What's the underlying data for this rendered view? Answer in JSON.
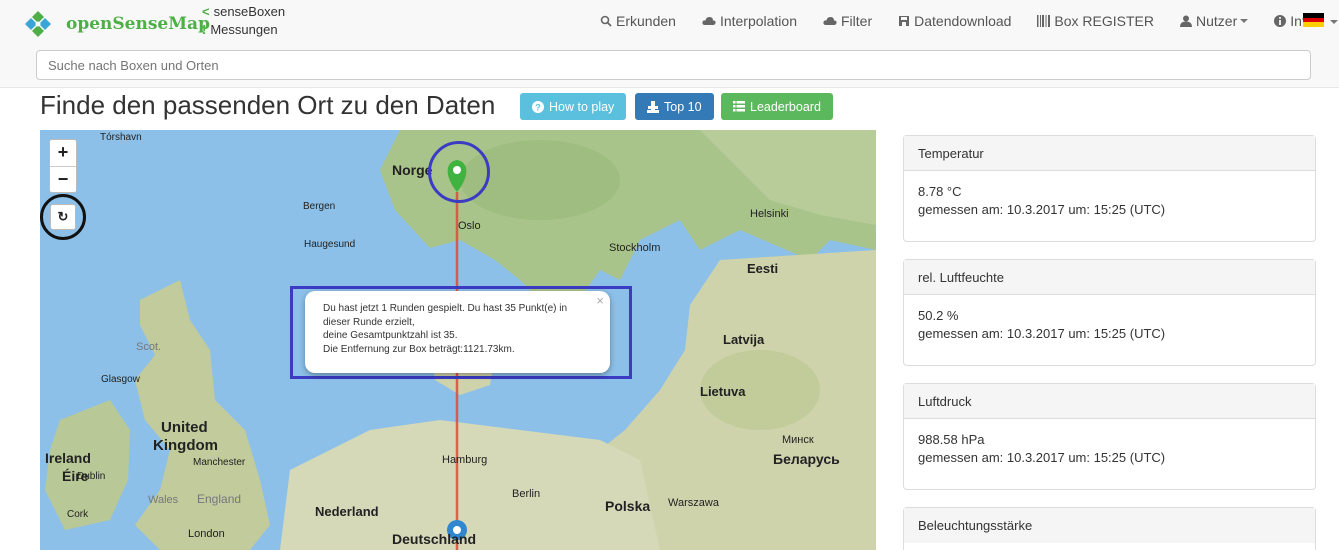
{
  "brand": {
    "name": "openSenseMap"
  },
  "sublinks": [
    {
      "mark": "<",
      "label": "senseBoxen"
    },
    {
      "mark": "!",
      "label": "Messungen"
    }
  ],
  "nav": {
    "explore": "Erkunden",
    "interpolation": "Interpolation",
    "filter": "Filter",
    "download": "Datendownload",
    "register": "Box REGISTER",
    "user": "Nutzer",
    "info": "Info"
  },
  "search": {
    "placeholder": "Suche nach Boxen und Orten"
  },
  "page": {
    "title": "Finde den passenden Ort zu den Daten"
  },
  "buttons": {
    "how": "How to play",
    "top": "Top 10",
    "leaderboard": "Leaderboard"
  },
  "map": {
    "labels": {
      "torshavn": "Tórshavn",
      "norge": "Norge",
      "bergen": "Bergen",
      "oslo": "Oslo",
      "haugesund": "Haugesund",
      "stockholm": "Stockholm",
      "helsinki": "Helsinki",
      "eesti": "Eesti",
      "latvija": "Latvija",
      "lietuva": "Lietuva",
      "scot": "Scot.",
      "glasgow": "Glasgow",
      "united": "United",
      "kingdom": "Kingdom",
      "ireland": "Ireland",
      "eire": "Éire",
      "manchester": "Manchester",
      "dublin": "Dublin",
      "wales": "Wales",
      "england": "England",
      "cork": "Cork",
      "london": "London",
      "hamburg": "Hamburg",
      "berlin": "Berlin",
      "nederland": "Nederland",
      "polska": "Polska",
      "warszawa": "Warszawa",
      "minsk": "Минск",
      "belarus": "Беларусь",
      "deutschland": "Deutschland"
    },
    "colors": {
      "water": "#8cc0e8",
      "land": "#d8dcc0",
      "forest": "#a9c48a",
      "line": "#e04a3a",
      "guess_pin": "#3fb23f",
      "box_pin": "#3087d0",
      "highlight_blue": "#3b3bc4",
      "highlight_black": "#111111"
    }
  },
  "zoom": {
    "in": "+",
    "out": "−",
    "reset": "↻"
  },
  "popup": {
    "close": "×",
    "line1": "Du hast jetzt 1 Runden gespielt. Du hast 35 Punkt(e) in",
    "line2": "dieser Runde erzielt,",
    "line3": "deine Gesamtpunktzahl ist 35.",
    "line4": "Die Entfernung zur Box beträgt:1121.73km."
  },
  "panels": [
    {
      "title": "Temperatur",
      "value": "8.78 °C",
      "measured": "gemessen am: 10.3.2017 um: 15:25 (UTC)"
    },
    {
      "title": "rel. Luftfeuchte",
      "value": "50.2 %",
      "measured": "gemessen am: 10.3.2017 um: 15:25 (UTC)"
    },
    {
      "title": "Luftdruck",
      "value": "988.58 hPa",
      "measured": "gemessen am: 10.3.2017 um: 15:25 (UTC)"
    },
    {
      "title": "Beleuchtungsstärke"
    }
  ]
}
